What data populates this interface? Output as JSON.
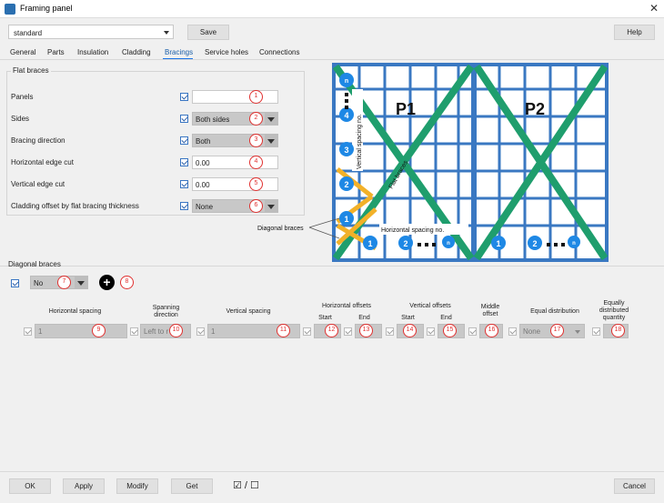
{
  "window": {
    "title": "Framing panel"
  },
  "preset": {
    "value": "standard",
    "save_label": "Save",
    "help_label": "Help"
  },
  "tabs": [
    "General",
    "Parts",
    "Insulation",
    "Cladding",
    "Bracings",
    "Service holes",
    "Connections"
  ],
  "flat_braces": {
    "group_label": "Flat braces",
    "rows": [
      {
        "label": "Panels",
        "value": "",
        "num": "1",
        "dropdown": false
      },
      {
        "label": "Sides",
        "value": "Both sides",
        "num": "2",
        "dropdown": true
      },
      {
        "label": "Bracing direction",
        "value": "Both",
        "num": "3",
        "dropdown": true
      },
      {
        "label": "Horizontal edge cut",
        "value": "0.00",
        "num": "4",
        "dropdown": false
      },
      {
        "label": "Vertical edge cut",
        "value": "0.00",
        "num": "5",
        "dropdown": false
      },
      {
        "label": "Cladding offset by flat bracing thickness",
        "value": "None",
        "num": "6",
        "dropdown": true
      }
    ]
  },
  "diagram": {
    "p1": "P1",
    "p2": "P2",
    "vertical_spacing_label": "Vertical spacing no.",
    "flat_braces_label": "Flat braces",
    "horizontal_spacing_label": "Horizontal spacing no.",
    "diagonal_braces_label": "Diagonal braces",
    "vert_markers": [
      "n",
      "4",
      "3",
      "2",
      "1"
    ],
    "horiz_markers_p1": [
      "1",
      "2",
      "n"
    ],
    "horiz_markers_p2": [
      "1",
      "2",
      "n"
    ],
    "colors": {
      "frame": "#3a78c2",
      "brace": "#1f9e6d",
      "diag": "#f2b129",
      "marker": "#1e88e5"
    }
  },
  "diagonal_braces": {
    "group_label": "Diagonal braces",
    "mode_value": "No",
    "mode_num": "7",
    "add_num": "8",
    "columns": [
      {
        "label": "Horizontal spacing"
      },
      {
        "label": "Spanning direction"
      },
      {
        "label": "Vertical spacing"
      },
      {
        "label": "Horizontal offsets"
      },
      {
        "label": "Start"
      },
      {
        "label": "End"
      },
      {
        "label": "Vertical offsets"
      },
      {
        "label": "Start"
      },
      {
        "label": "End"
      },
      {
        "label": "Middle offset"
      },
      {
        "label": "Equal distribution"
      },
      {
        "label": "Equally distributed quantity"
      }
    ],
    "row": {
      "horizontal_spacing": "1",
      "n9": "9",
      "spanning": "Left to r",
      "n10": "10",
      "vertical_spacing": "1",
      "n11": "11",
      "n12": "12",
      "n13": "13",
      "n14": "14",
      "n15": "15",
      "n16": "16",
      "equal_dist": "None",
      "n17": "17",
      "eq_qty": "",
      "n18": "18"
    }
  },
  "footer": {
    "ok": "OK",
    "apply": "Apply",
    "modify": "Modify",
    "get": "Get",
    "toggle": "☑ / ☐",
    "cancel": "Cancel"
  }
}
